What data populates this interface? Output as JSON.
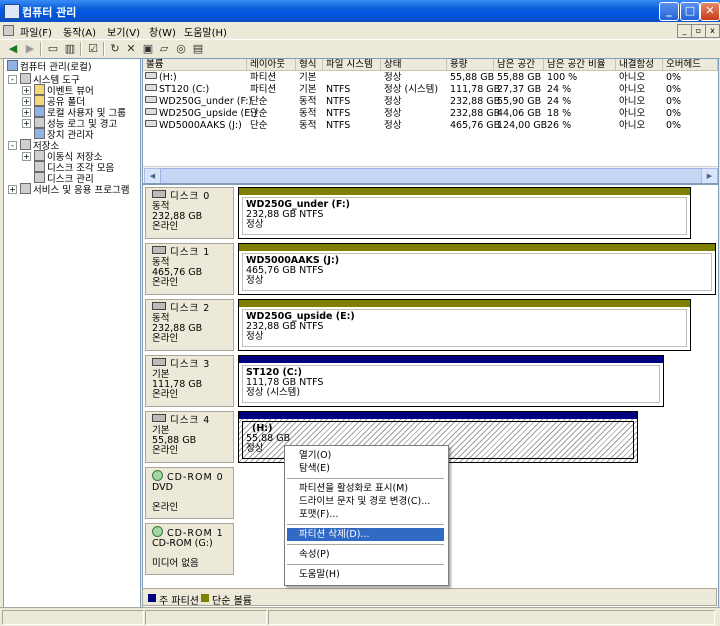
{
  "window": {
    "title": "컴퓨터 관리"
  },
  "menubar": [
    "파일(F)",
    "동작(A)",
    "보기(V)",
    "창(W)",
    "도움말(H)"
  ],
  "toolbar": {
    "icons": [
      "back-arrow-icon",
      "forward-arrow-icon",
      "up-folder-icon",
      "show-tree-icon",
      "properties-icon",
      "refresh-icon",
      "delete-icon",
      "export-icon",
      "open-icon",
      "help-icon",
      "details-icon"
    ]
  },
  "tree": {
    "root": "컴퓨터 관리(로컬)",
    "items": [
      {
        "label": "시스템 도구",
        "level": 1,
        "expander": "-"
      },
      {
        "label": "이벤트 뷰어",
        "level": 2,
        "expander": "+"
      },
      {
        "label": "공유 폴더",
        "level": 2,
        "expander": "+"
      },
      {
        "label": "로컬 사용자 및 그룹",
        "level": 2,
        "expander": "+"
      },
      {
        "label": "성능 로그 및 경고",
        "level": 2,
        "expander": "+"
      },
      {
        "label": "장치 관리자",
        "level": 2,
        "expander": ""
      },
      {
        "label": "저장소",
        "level": 1,
        "expander": "-"
      },
      {
        "label": "이동식 저장소",
        "level": 2,
        "expander": "+"
      },
      {
        "label": "디스크 조각 모음",
        "level": 2,
        "expander": ""
      },
      {
        "label": "디스크 관리",
        "level": 2,
        "expander": ""
      },
      {
        "label": "서비스 및 응용 프로그램",
        "level": 1,
        "expander": "+"
      }
    ]
  },
  "volume_list": {
    "columns": [
      "볼륨",
      "레이아웃",
      "형식",
      "파일 시스템",
      "상태",
      "용량",
      "남은 공간",
      "남은 공간 비율",
      "내결함성",
      "오버헤드"
    ],
    "rows": [
      [
        "(H:)",
        "파티션",
        "기본",
        "",
        "정상",
        "55,88 GB",
        "55,88 GB",
        "100 %",
        "아니오",
        "0%"
      ],
      [
        "ST120 (C:)",
        "파티션",
        "기본",
        "NTFS",
        "정상 (시스템)",
        "111,78 GB",
        "27,37 GB",
        "24 %",
        "아니오",
        "0%"
      ],
      [
        "WD250G_under (F:)",
        "단순",
        "동적",
        "NTFS",
        "정상",
        "232,88 GB",
        "55,90 GB",
        "24 %",
        "아니오",
        "0%"
      ],
      [
        "WD250G_upside (E:)",
        "단순",
        "동적",
        "NTFS",
        "정상",
        "232,88 GB",
        "44,06 GB",
        "18 %",
        "아니오",
        "0%"
      ],
      [
        "WD5000AAKS (J:)",
        "단순",
        "동적",
        "NTFS",
        "정상",
        "465,76 GB",
        "124,00 GB",
        "26 %",
        "아니오",
        "0%"
      ]
    ]
  },
  "disks": [
    {
      "name": "디스크 0",
      "type": "동적",
      "size": "232,88 GB",
      "status": "온라인",
      "volume": {
        "name": "WD250G_under  (F:)",
        "detail": "232,88 GB NTFS",
        "state": "정상"
      }
    },
    {
      "name": "디스크 1",
      "type": "동적",
      "size": "465,76 GB",
      "status": "온라인",
      "volume": {
        "name": "WD5000AAKS  (J:)",
        "detail": "465,76 GB NTFS",
        "state": "정상"
      }
    },
    {
      "name": "디스크 2",
      "type": "동적",
      "size": "232,88 GB",
      "status": "온라인",
      "volume": {
        "name": "WD250G_upside  (E:)",
        "detail": "232,88 GB NTFS",
        "state": "정상"
      }
    },
    {
      "name": "디스크 3",
      "type": "기본",
      "size": "111,78 GB",
      "status": "온라인",
      "volume": {
        "name": "ST120  (C:)",
        "detail": "111,78 GB NTFS",
        "state": "정상 (시스템)"
      }
    },
    {
      "name": "디스크 4",
      "type": "기본",
      "size": "55,88 GB",
      "status": "온라인",
      "volume": {
        "name": "(H:)",
        "detail": "55,88 GB",
        "state": "정상"
      }
    }
  ],
  "cdroms": [
    {
      "name": "CD-ROM 0",
      "type": "DVD",
      "size": "",
      "status": "온라인"
    },
    {
      "name": "CD-ROM 1",
      "type": "CD-ROM (G:)",
      "size": "",
      "status": "미디어 없음"
    }
  ],
  "legend": {
    "primary": "주 파티션",
    "simple": "단순 볼륨"
  },
  "context_menu": {
    "items": [
      "열기(O)",
      "탐색(E)",
      "파티션을 활성화로 표시(M)",
      "드라이브 문자 및 경로 변경(C)...",
      "포맷(F)...",
      "파티션 삭제(D)...",
      "속성(P)",
      "도움말(H)"
    ],
    "highlighted": "파티션 삭제(D)..."
  },
  "colors": {
    "primary_partition": "#000080",
    "simple_volume": "#808000",
    "highlight": "#316ac5"
  }
}
